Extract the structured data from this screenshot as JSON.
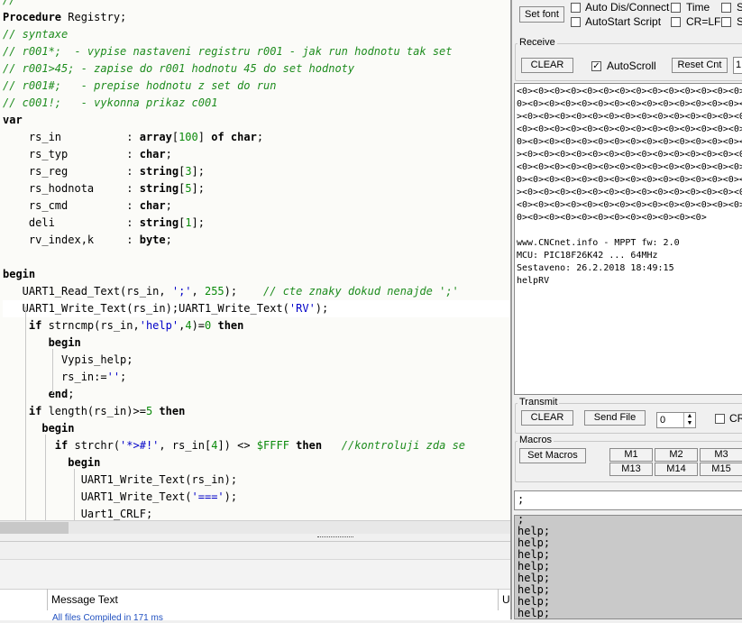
{
  "editor": {
    "lines": [
      "//",
      "Procedure Registry;",
      "// syntaxe",
      "// r001*;  - vypise nastaveni registru r001 - jak run hodnotu tak set",
      "// r001>45; - zapise do r001 hodnotu 45 do set hodnoty",
      "// r001#;   - prepise hodnotu z set do run",
      "// c001!;   - vykonna prikaz c001",
      "var",
      "    rs_in          : array[100] of char;",
      "    rs_typ         : char;",
      "    rs_reg         : string[3];",
      "    rs_hodnota     : string[5];",
      "    rs_cmd         : char;",
      "    deli           : string[1];",
      "    rv_index,k     : byte;",
      "",
      "begin",
      "   UART1_Read_Text(rs_in, ';', 255);    // cte znaky dokud nenajde ';'",
      "   UART1_Write_Text(rs_in);UART1_Write_Text('RV');",
      "    if strncmp(rs_in,'help',4)=0 then",
      "       begin",
      "         Vypis_help;",
      "         rs_in:='';",
      "       end;",
      "    if length(rs_in)>=5 then",
      "      begin",
      "        if strchr('*>#!', rs_in[4]) <> $FFFF then   //kontroluji zda se",
      "          begin",
      "            UART1_Write_Text(rs_in);",
      "            UART1_Write_Text('===');",
      "            Uart1_CRLF;"
    ]
  },
  "messages": {
    "header": "Message Text",
    "header_right": "U",
    "line1": "All files Compiled in 171 ms"
  },
  "terminal": {
    "set_font": "Set font",
    "auto_dis_connect": "Auto Dis/Connect",
    "time": "Time",
    "s1": "S",
    "autostart_script": "AutoStart Script",
    "cr_lf": "CR=LF",
    "s2": "S",
    "receive": {
      "title": "Receive",
      "clear": "CLEAR",
      "autoscroll": "AutoScroll",
      "reset_cnt": "Reset Cnt",
      "field_value": "1",
      "lines": [
        "<0><0><0><0><0><0><0><0><0><0><0><0><0><0>",
        "0><0><0><0><0><0><0><0><0><0><0><0><0><0><",
        "><0><0><0><0><0><0><0><0><0><0><0><0><0><0",
        "<0><0><0><0><0><0><0><0><0><0><0><0><0><0>",
        "0><0><0><0><0><0><0><0><0><0><0><0><0><0><",
        "><0><0><0><0><0><0><0><0><0><0><0><0><0><0",
        "<0><0><0><0><0><0><0><0><0><0><0><0><0><0>",
        "0><0><0><0><0><0><0><0><0><0><0><0><0><0><",
        "><0><0><0><0><0><0><0><0><0><0><0><0><0><0",
        "<0><0><0><0><0><0><0><0><0><0><0><0><0><0>",
        "0><0><0><0><0><0><0><0><0><0><0><0>",
        "",
        "www.CNCnet.info - MPPT fw: 2.0",
        "MCU: PIC18F26K42 ... 64MHz",
        "Sestaveno: 26.2.2018 18:49:15",
        "helpRV"
      ]
    },
    "transmit": {
      "title": "Transmit",
      "clear": "CLEAR",
      "send_file": "Send File",
      "spin_value": "0",
      "cr": "CR"
    },
    "macros": {
      "title": "Macros",
      "set_macros": "Set Macros",
      "m1": "M1",
      "m2": "M2",
      "m3": "M3",
      "m13": "M13",
      "m14": "M14",
      "m15": "M15"
    },
    "input_value": ";",
    "log": [
      ";",
      "help;",
      "help;",
      "help;",
      "help;",
      "help;",
      "help;",
      "help;",
      "help;"
    ]
  },
  "colors": {
    "comment": "#1e8c1e",
    "string": "#0000c8",
    "number": "#0a8a0a",
    "log_bg": "#c9c9c9"
  }
}
